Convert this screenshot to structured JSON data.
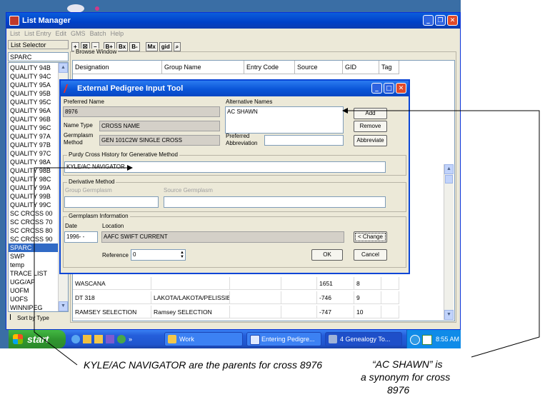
{
  "main_window": {
    "title": "List Manager",
    "menu": [
      "List",
      "List Entry",
      "Edit",
      "GMS",
      "Batch",
      "Help"
    ],
    "toolbar": [
      "+",
      "☒",
      "−",
      "B+",
      "Bx",
      "B-",
      "Mx",
      "gid"
    ],
    "list_selector_label": "List Selector",
    "list_selector_value": "SPARC",
    "browse_window_label": "Browse Window",
    "lists": [
      "QUALITY 94B",
      "QUALITY 94C",
      "QUALITY 95A",
      "QUALITY 95B",
      "QUALITY 95C",
      "QUALITY 96A",
      "QUALITY 96B",
      "QUALITY 96C",
      "QUALITY 97A",
      "QUALITY 97B",
      "QUALITY 97C",
      "QUALITY 98A",
      "QUALITY 98B",
      "QUALITY 98C",
      "QUALITY 99A",
      "QUALITY 99B",
      "QUALITY 99C",
      "SC CROSS 00",
      "SC CROSS 70",
      "SC CROSS 80",
      "SC CROSS 90",
      "SPARC",
      "SWP",
      "temp",
      "TRACE LIST",
      "UGG/AP",
      "UOFM",
      "UOFS",
      "WINNIPEG"
    ],
    "selected_list": "SPARC",
    "sort_by_type": "Sort by Type",
    "columns": [
      "Designation",
      "Group Name",
      "Entry Code",
      "Source",
      "GID",
      "Tag"
    ],
    "rows": [
      [
        "WASCANA",
        "",
        "",
        "",
        "1651",
        "8",
        ""
      ],
      [
        "DT 318",
        "LAKOTA/LAKOTA/PELISSIE",
        "",
        "",
        "-746",
        "9",
        ""
      ],
      [
        "RAMSEY SELECTION",
        "Ramsey SELECTION",
        "",
        "",
        "-747",
        "10",
        ""
      ]
    ]
  },
  "dialog": {
    "title": "External Pedigree Input Tool",
    "preferred_name_label": "Preferred Name",
    "preferred_name": "8976",
    "name_type_label": "Name Type",
    "name_type": "CROSS NAME",
    "germplasm_method_label_1": "Germplasm",
    "germplasm_method_label_2": "Method",
    "germplasm_method": "GEN  101C2W SINGLE CROSS",
    "alt_names_label": "Alternative Names",
    "alt_names": "AC SHAWN",
    "pref_abbrev_label_1": "Preferred",
    "pref_abbrev_label_2": "Abbreviation",
    "pref_abbrev": "",
    "add": "Add",
    "remove": "Remove",
    "abbreviate": "Abbreviate",
    "purdy_label": "Purdy Cross History for Generative Method",
    "purdy": "KYLE/AC NAVIGATOR",
    "derivative_label": "Derivative Method",
    "group_germplasm_label": "Group Germplasm",
    "source_germplasm_label": "Source Germplasm",
    "germplasm_info_label": "Germplasm Information",
    "date_label": "Date",
    "date": "1996-  -",
    "location_label": "Location",
    "location": "AAFC SWIFT CURRENT",
    "change": "< Change",
    "reference_label": "Reference",
    "reference": "0",
    "ok": "OK",
    "cancel": "Cancel"
  },
  "taskbar": {
    "start": "start",
    "tasks": [
      "Work",
      "Entering Pedigre...",
      "4 Genealogy To..."
    ],
    "clock": "8:55 AM"
  },
  "annotations": {
    "parents_note": "KYLE/AC NAVIGATOR are the parents for cross 8976",
    "synonym_note_1": "“AC SHAWN” is",
    "synonym_note_2": "a synonym for cross",
    "synonym_note_3": "8976"
  },
  "colors": {
    "titlebar": "#0a5ddc",
    "selection": "#316ac5",
    "window_bg": "#ece9d8",
    "taskbar": "#245edb",
    "start": "#2f962f"
  }
}
